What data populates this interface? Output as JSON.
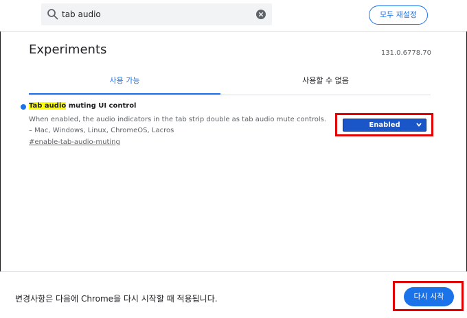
{
  "search": {
    "value": "tab audio",
    "icon": "search-icon",
    "clear_icon": "clear-icon"
  },
  "header": {
    "reset_all_label": "모두 재설정"
  },
  "page": {
    "title": "Experiments",
    "version": "131.0.6778.70"
  },
  "tabs": [
    {
      "label": "사용 가능",
      "selected": true
    },
    {
      "label": "사용할 수 없음",
      "selected": false
    }
  ],
  "experiment": {
    "name_highlight": "Tab audio",
    "name_rest": " muting UI control",
    "description": "When enabled, the audio indicators in the tab strip double as tab audio mute controls. – Mac, Windows, Linux, ChromeOS, Lacros",
    "link": "#enable-tab-audio-muting",
    "selected_option": "Enabled"
  },
  "footer": {
    "message": "변경사항은 다음에 Chrome을 다시 시작할 때 적용됩니다.",
    "relaunch_label": "다시 시작"
  },
  "colors": {
    "accent": "#1a73e8",
    "highlight": "#ffff00",
    "annotation_box": "#e00000"
  }
}
